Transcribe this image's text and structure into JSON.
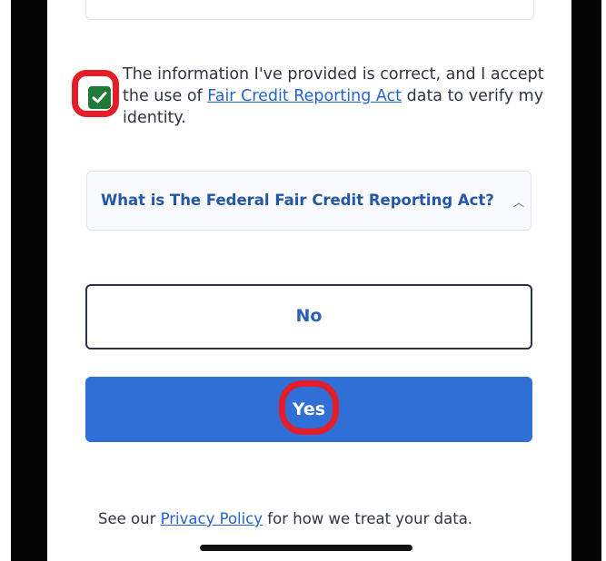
{
  "consent": {
    "checked": true,
    "text_before": "The information I've provided is correct, and I accept the use of ",
    "link_text": "Fair Credit Reporting Act",
    "text_after": " data to verify my identity."
  },
  "accordion": {
    "title": "What is The Federal Fair Credit Reporting Act?",
    "icon": "chevron-up-icon"
  },
  "buttons": {
    "no_label": "No",
    "yes_label": "Yes"
  },
  "footer": {
    "text_before": "See our ",
    "link_text": "Privacy Policy",
    "text_after": " for how we treat your data."
  },
  "colors": {
    "checkbox_fill": "#1f7a3a",
    "primary_button": "#2f6fd6",
    "link": "#2564cc",
    "highlight_circle": "#e41d2a"
  }
}
